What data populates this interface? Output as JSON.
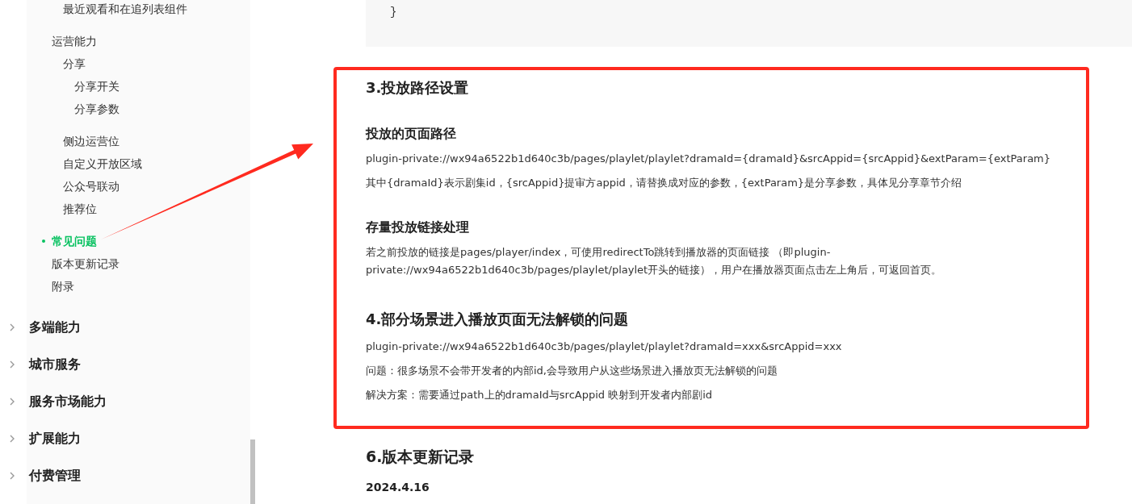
{
  "sidebar": {
    "outline": [
      {
        "children": [
          {
            "label": "最近观看和在追列表组件",
            "selected": false
          }
        ]
      },
      {
        "label": "运营能力",
        "selected": false,
        "children": [
          {
            "label": "分享",
            "selected": false,
            "children": [
              {
                "label": "分享开关",
                "selected": false
              },
              {
                "label": "分享参数",
                "selected": false
              }
            ]
          },
          {
            "label": "侧边运营位",
            "selected": false
          },
          {
            "label": "自定义开放区域",
            "selected": false
          },
          {
            "label": "公众号联动",
            "selected": false
          },
          {
            "label": "推荐位",
            "selected": false
          }
        ]
      },
      {
        "label": "常见问题",
        "selected": true
      },
      {
        "label": "版本更新记录",
        "selected": false
      },
      {
        "label": "附录",
        "selected": false
      }
    ],
    "sections": [
      {
        "label": "多端能力",
        "expanded": false
      },
      {
        "label": "城市服务",
        "expanded": false
      },
      {
        "label": "服务市场能力",
        "expanded": false
      },
      {
        "label": "扩展能力",
        "expanded": false
      },
      {
        "label": "付费管理",
        "expanded": false
      }
    ]
  },
  "content": {
    "code_tail": "}",
    "highlighted": [
      {
        "kind": "heading",
        "text": "3.投放路径设置"
      },
      {
        "kind": "subheading",
        "text": "投放的页面路径"
      },
      {
        "kind": "paragraph",
        "text": "plugin-private://wx94a6522b1d640c3b/pages/playlet/playlet?dramaId={dramaId}&srcAppid={srcAppid}&extParam={extParam}"
      },
      {
        "kind": "paragraph",
        "text": "其中{dramaId}表示剧集id，{srcAppid}提审方appid，请替换成对应的参数，{extParam}是分享参数，具体见分享章节介绍"
      },
      {
        "kind": "subheading",
        "text": "存量投放链接处理"
      },
      {
        "kind": "paragraph",
        "text": "若之前投放的链接是pages/player/index，可使用redirectTo跳转到播放器的页面链接 （即plugin-private://wx94a6522b1d640c3b/pages/playlet/playlet开头的链接），用户在播放器页面点击左上角后，可返回首页。"
      },
      {
        "kind": "heading",
        "text": "4.部分场景进入播放页面无法解锁的问题"
      },
      {
        "kind": "paragraph",
        "text": "plugin-private://wx94a6522b1d640c3b/pages/playlet/playlet?dramaId=xxx&srcAppid=xxx"
      },
      {
        "kind": "paragraph",
        "text": "问题：很多场景不会带开发者的内部id,会导致用户从这些场景进入播放页无法解锁的问题"
      },
      {
        "kind": "paragraph",
        "text": "解决方案：需要通过path上的dramaId与srcAppid 映射到开发者内部剧id"
      }
    ],
    "after": [
      {
        "kind": "section-title",
        "text": "6.版本更新记录"
      },
      {
        "kind": "date",
        "text": "2024.4.16"
      }
    ]
  }
}
